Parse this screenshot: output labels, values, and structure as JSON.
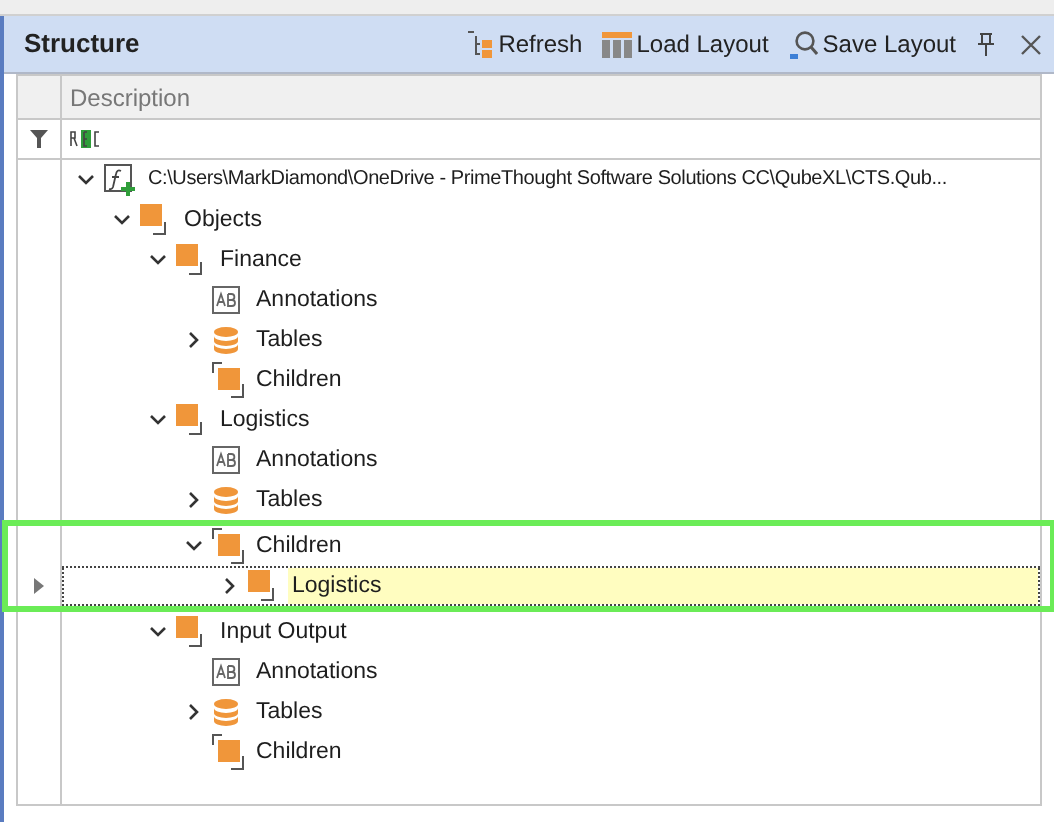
{
  "panel": {
    "title": "Structure",
    "actions": [
      {
        "kind": "refresh",
        "label": "Refresh"
      },
      {
        "kind": "load",
        "label": "Load Layout"
      },
      {
        "kind": "save",
        "label": "Save Layout"
      }
    ]
  },
  "grid": {
    "column": "Description",
    "tree": [
      {
        "kind": "file",
        "label": "C:\\Users\\MarkDiamond\\OneDrive - PrimeThought Software Solutions CC\\QubeXL\\CTS.Qub...",
        "expanded": true,
        "children": [
          {
            "kind": "object",
            "label": "Objects",
            "expanded": true,
            "children": [
              {
                "kind": "object",
                "label": "Finance",
                "expanded": true,
                "children": [
                  {
                    "kind": "annotations",
                    "label": "Annotations"
                  },
                  {
                    "kind": "tables",
                    "label": "Tables",
                    "expanded": false
                  },
                  {
                    "kind": "children",
                    "label": "Children"
                  }
                ]
              },
              {
                "kind": "object",
                "label": "Logistics",
                "expanded": true,
                "children": [
                  {
                    "kind": "annotations",
                    "label": "Annotations"
                  },
                  {
                    "kind": "tables",
                    "label": "Tables",
                    "expanded": false
                  },
                  {
                    "kind": "children",
                    "label": "Children",
                    "expanded": true,
                    "highlighted": true,
                    "children": [
                      {
                        "kind": "object",
                        "label": "Logistics",
                        "expanded": false,
                        "highlighted": true,
                        "selected": true
                      }
                    ]
                  }
                ]
              },
              {
                "kind": "object",
                "label": "Input Output",
                "expanded": true,
                "children": [
                  {
                    "kind": "annotations",
                    "label": "Annotations"
                  },
                  {
                    "kind": "tables",
                    "label": "Tables",
                    "expanded": false
                  },
                  {
                    "kind": "children",
                    "label": "Children"
                  }
                ]
              }
            ]
          }
        ]
      }
    ]
  }
}
